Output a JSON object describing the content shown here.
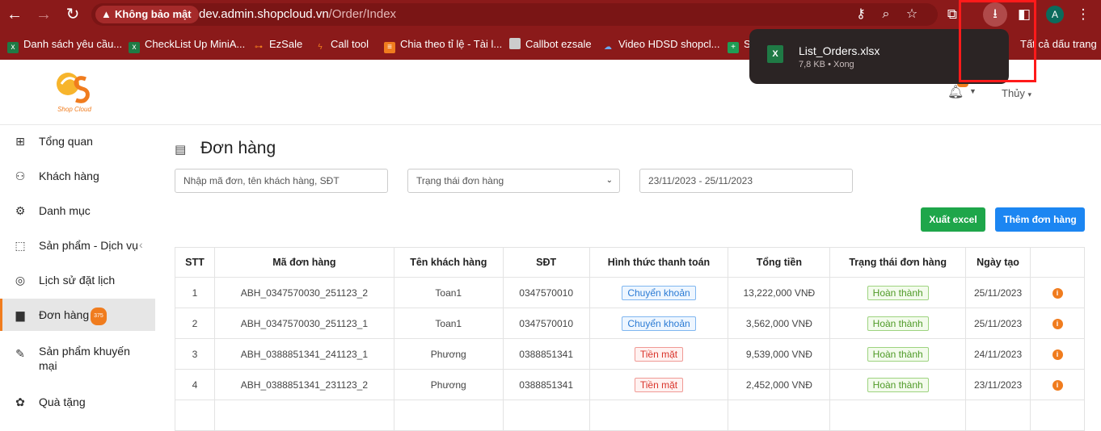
{
  "browser": {
    "security_label": "Không bảo mật",
    "url_host": "dev.admin.shopcloud.vn",
    "url_path": "/Order/Index",
    "avatar_letter": "A",
    "bookmarks": [
      {
        "label": "Danh sách yêu cầu...",
        "icon": "excel-icon",
        "color": "#1f7a45"
      },
      {
        "label": "CheckList Up MiniA...",
        "icon": "excel-icon",
        "color": "#1f7a45"
      },
      {
        "label": "EzSale",
        "icon": "ezsale-icon",
        "color": "#f07c1e"
      },
      {
        "label": "Call tool",
        "icon": "call-tool-icon",
        "color": "#f07c1e"
      },
      {
        "label": "Chia theo tỉ lệ - Tài l...",
        "icon": "doc-icon",
        "color": "#f07c1e"
      },
      {
        "label": "Callbot ezsale",
        "icon": "page-icon",
        "color": "#cccccc"
      },
      {
        "label": "Video HDSD shopcl...",
        "icon": "cloud-icon",
        "color": "#2b7bd4"
      },
      {
        "label": "S",
        "icon": "sheets-icon",
        "color": "#1f9d55"
      }
    ],
    "all_bookmarks_label": "Tất cả dấu trang"
  },
  "download": {
    "file_name": "List_Orders.xlsx",
    "meta": "7,8 KB • Xong",
    "icon_text": "X"
  },
  "header": {
    "logo_text": "Shop Cloud",
    "user_name": "Thủy"
  },
  "sidebar": {
    "items": [
      {
        "label": "Tổng quan",
        "icon": "grid-icon"
      },
      {
        "label": "Khách hàng",
        "icon": "users-icon"
      },
      {
        "label": "Danh mục",
        "icon": "category-icon"
      },
      {
        "label": "Sản phẩm - Dịch vụ",
        "icon": "box-icon"
      },
      {
        "label": "Lịch sử đặt lịch",
        "icon": "history-icon"
      },
      {
        "label": "Đơn hàng",
        "icon": "order-icon",
        "badge": "375"
      },
      {
        "label": "Sản phẩm khuyến mại",
        "icon": "promo-icon"
      },
      {
        "label": "Quà tặng",
        "icon": "gift-icon"
      }
    ]
  },
  "page": {
    "title": "Đơn hàng",
    "search_placeholder": "Nhập mã đơn, tên khách hàng, SĐT",
    "status_select": "Trạng thái đơn hàng",
    "date_range": "23/11/2023 - 25/11/2023",
    "export_button": "Xuất excel",
    "add_button": "Thêm đơn hàng"
  },
  "table": {
    "headers": [
      "STT",
      "Mã đơn hàng",
      "Tên khách hàng",
      "SĐT",
      "Hình thức thanh toán",
      "Tổng tiền",
      "Trạng thái đơn hàng",
      "Ngày tạo",
      ""
    ],
    "rows": [
      {
        "stt": "1",
        "code": "ABH_0347570030_251123_2",
        "customer": "Toan1",
        "phone": "0347570010",
        "payment": "Chuyển khoản",
        "payment_color": "blue",
        "total": "13,222,000 VNĐ",
        "status": "Hoàn thành",
        "date": "25/11/2023"
      },
      {
        "stt": "2",
        "code": "ABH_0347570030_251123_1",
        "customer": "Toan1",
        "phone": "0347570010",
        "payment": "Chuyển khoản",
        "payment_color": "blue",
        "total": "3,562,000 VNĐ",
        "status": "Hoàn thành",
        "date": "25/11/2023"
      },
      {
        "stt": "3",
        "code": "ABH_0388851341_241123_1",
        "customer": "Phương",
        "phone": "0388851341",
        "payment": "Tiền mặt",
        "payment_color": "red",
        "total": "9,539,000 VNĐ",
        "status": "Hoàn thành",
        "date": "24/11/2023"
      },
      {
        "stt": "4",
        "code": "ABH_0388851341_231123_2",
        "customer": "Phương",
        "phone": "0388851341",
        "payment": "Tiền mặt",
        "payment_color": "red",
        "total": "2,452,000 VNĐ",
        "status": "Hoàn thành",
        "date": "23/11/2023"
      }
    ]
  },
  "colors": {
    "accent_orange": "#f07c1e",
    "export_green": "#1ea64a",
    "add_blue": "#1c86f2",
    "browser_chrome": "#8b1a1a"
  }
}
